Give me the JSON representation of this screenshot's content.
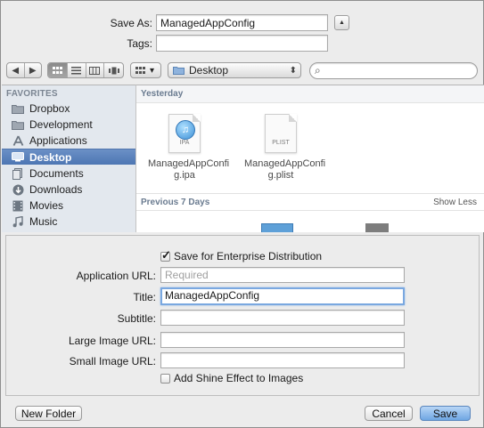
{
  "save_as": {
    "label": "Save As:",
    "value": "ManagedAppConfig",
    "tags_label": "Tags:",
    "tags_value": "",
    "collapse_glyph": "▲"
  },
  "toolbar": {
    "back_glyph": "◀",
    "forward_glyph": "▶",
    "arrange_glyph": "▾",
    "location": "Desktop",
    "location_glyph": "⬍",
    "search_glyph": "⌕",
    "search_placeholder": ""
  },
  "sidebar": {
    "heading": "FAVORITES",
    "items": [
      {
        "label": "Dropbox",
        "icon": "folder-icon"
      },
      {
        "label": "Development",
        "icon": "folder-icon"
      },
      {
        "label": "Applications",
        "icon": "applications-icon"
      },
      {
        "label": "Desktop",
        "icon": "desktop-icon"
      },
      {
        "label": "Documents",
        "icon": "documents-icon"
      },
      {
        "label": "Downloads",
        "icon": "downloads-icon"
      },
      {
        "label": "Movies",
        "icon": "movies-icon"
      },
      {
        "label": "Music",
        "icon": "music-icon"
      }
    ],
    "selected": "Desktop"
  },
  "content": {
    "group_yesterday": "Yesterday",
    "group_previous": "Previous 7 Days",
    "show_less": "Show Less",
    "files": [
      {
        "name": "ManagedAppConfi g.ipa",
        "tag": "IPA"
      },
      {
        "name": "ManagedAppConfi g.plist",
        "tag": "PLIST"
      }
    ]
  },
  "accessory": {
    "enterprise_label": "Save for Enterprise Distribution",
    "enterprise_checked": true,
    "app_url_label": "Application URL:",
    "app_url_placeholder": "Required",
    "title_label": "Title:",
    "title_value": "ManagedAppConfig",
    "subtitle_label": "Subtitle:",
    "subtitle_value": "",
    "large_image_label": "Large Image URL:",
    "large_image_value": "",
    "small_image_label": "Small Image URL:",
    "small_image_value": "",
    "shine_label": "Add Shine Effect to Images",
    "shine_checked": false
  },
  "buttons": {
    "new_folder": "New Folder",
    "cancel": "Cancel",
    "save": "Save"
  }
}
